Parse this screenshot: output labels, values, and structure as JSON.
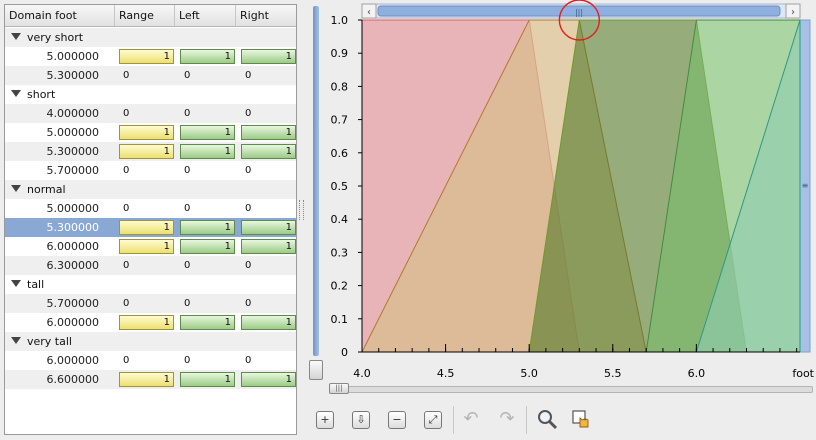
{
  "table": {
    "headers": [
      "Domain foot",
      "Range",
      "Left",
      "Right"
    ],
    "rows": [
      {
        "kind": "group",
        "label": "very short"
      },
      {
        "kind": "value",
        "value": "5.000000",
        "range": "1",
        "left": "1",
        "right": "1",
        "on": true
      },
      {
        "kind": "value",
        "value": "5.300000",
        "range": "0",
        "left": "0",
        "right": "0",
        "on": false
      },
      {
        "kind": "group",
        "label": "short"
      },
      {
        "kind": "value",
        "value": "4.000000",
        "range": "0",
        "left": "0",
        "right": "0",
        "on": false
      },
      {
        "kind": "value",
        "value": "5.000000",
        "range": "1",
        "left": "1",
        "right": "1",
        "on": true
      },
      {
        "kind": "value",
        "value": "5.300000",
        "range": "1",
        "left": "1",
        "right": "1",
        "on": true
      },
      {
        "kind": "value",
        "value": "5.700000",
        "range": "0",
        "left": "0",
        "right": "0",
        "on": false
      },
      {
        "kind": "group",
        "label": "normal"
      },
      {
        "kind": "value",
        "value": "5.000000",
        "range": "0",
        "left": "0",
        "right": "0",
        "on": false
      },
      {
        "kind": "value",
        "value": "5.300000",
        "range": "1",
        "left": "1",
        "right": "1",
        "on": true,
        "selected": true
      },
      {
        "kind": "value",
        "value": "6.000000",
        "range": "1",
        "left": "1",
        "right": "1",
        "on": true
      },
      {
        "kind": "value",
        "value": "6.300000",
        "range": "0",
        "left": "0",
        "right": "0",
        "on": false
      },
      {
        "kind": "group",
        "label": "tall"
      },
      {
        "kind": "value",
        "value": "5.700000",
        "range": "0",
        "left": "0",
        "right": "0",
        "on": false
      },
      {
        "kind": "value",
        "value": "6.000000",
        "range": "1",
        "left": "1",
        "right": "1",
        "on": true
      },
      {
        "kind": "group",
        "label": "very tall"
      },
      {
        "kind": "value",
        "value": "6.000000",
        "range": "0",
        "left": "0",
        "right": "0",
        "on": false
      },
      {
        "kind": "value",
        "value": "6.600000",
        "range": "1",
        "left": "1",
        "right": "1",
        "on": true
      }
    ]
  },
  "chart_data": {
    "type": "area",
    "xlim": [
      4.0,
      6.62
    ],
    "ylim": [
      0,
      1.0
    ],
    "x_ticks": [
      "4.0",
      "4.5",
      "5.0",
      "5.5",
      "6.0"
    ],
    "x_tick_values": [
      4.0,
      4.5,
      5.0,
      5.5,
      6.0
    ],
    "x_unit_label": "foot",
    "y_ticks": [
      "0",
      "0.1",
      "0.2",
      "0.3",
      "0.4",
      "0.5",
      "0.6",
      "0.7",
      "0.8",
      "0.9",
      "1.0"
    ],
    "y_tick_values": [
      0,
      0.1,
      0.2,
      0.3,
      0.4,
      0.5,
      0.6,
      0.7,
      0.8,
      0.9,
      1.0
    ],
    "series": [
      {
        "points": [
          [
            4.0,
            1
          ],
          [
            5.0,
            1
          ],
          [
            5.3,
            0
          ],
          [
            4.0,
            0
          ]
        ],
        "fill": "#e3a3a8",
        "stroke": "#e06060",
        "opacity": 0.82
      },
      {
        "points": [
          [
            4.0,
            0
          ],
          [
            5.0,
            1
          ],
          [
            5.3,
            1
          ],
          [
            5.7,
            0
          ]
        ],
        "fill": "#d8bc8c",
        "stroke": "#b07a30",
        "opacity": 0.72
      },
      {
        "points": [
          [
            5.0,
            0
          ],
          [
            5.3,
            1
          ],
          [
            6.0,
            1
          ],
          [
            6.3,
            0
          ]
        ],
        "fill": "#557a2a",
        "stroke": "#6f9a2a",
        "opacity": 0.62
      },
      {
        "points": [
          [
            5.7,
            0
          ],
          [
            6.0,
            1
          ],
          [
            6.62,
            1
          ],
          [
            6.62,
            0
          ]
        ],
        "fill": "#79bb6c",
        "stroke": "#3f8d3f",
        "opacity": 0.62
      },
      {
        "points": [
          [
            6.0,
            0
          ],
          [
            6.62,
            1
          ],
          [
            6.62,
            0
          ]
        ],
        "fill": "#90cdb0",
        "stroke": "#2a9a82",
        "opacity": 0.62
      }
    ],
    "highlight": {
      "x": 5.3,
      "y": 1.0
    }
  },
  "toolbar": {
    "icons": [
      "add-icon",
      "import-icon",
      "remove-icon",
      "fit-icon",
      "undo-icon",
      "redo-icon",
      "zoom-icon",
      "pan-icon"
    ]
  },
  "colors": {
    "selection": "#8aa8d4",
    "scrollbar": "#a7c1e6",
    "active_cell": "#ece070",
    "green_cell": "#9ccb86"
  }
}
